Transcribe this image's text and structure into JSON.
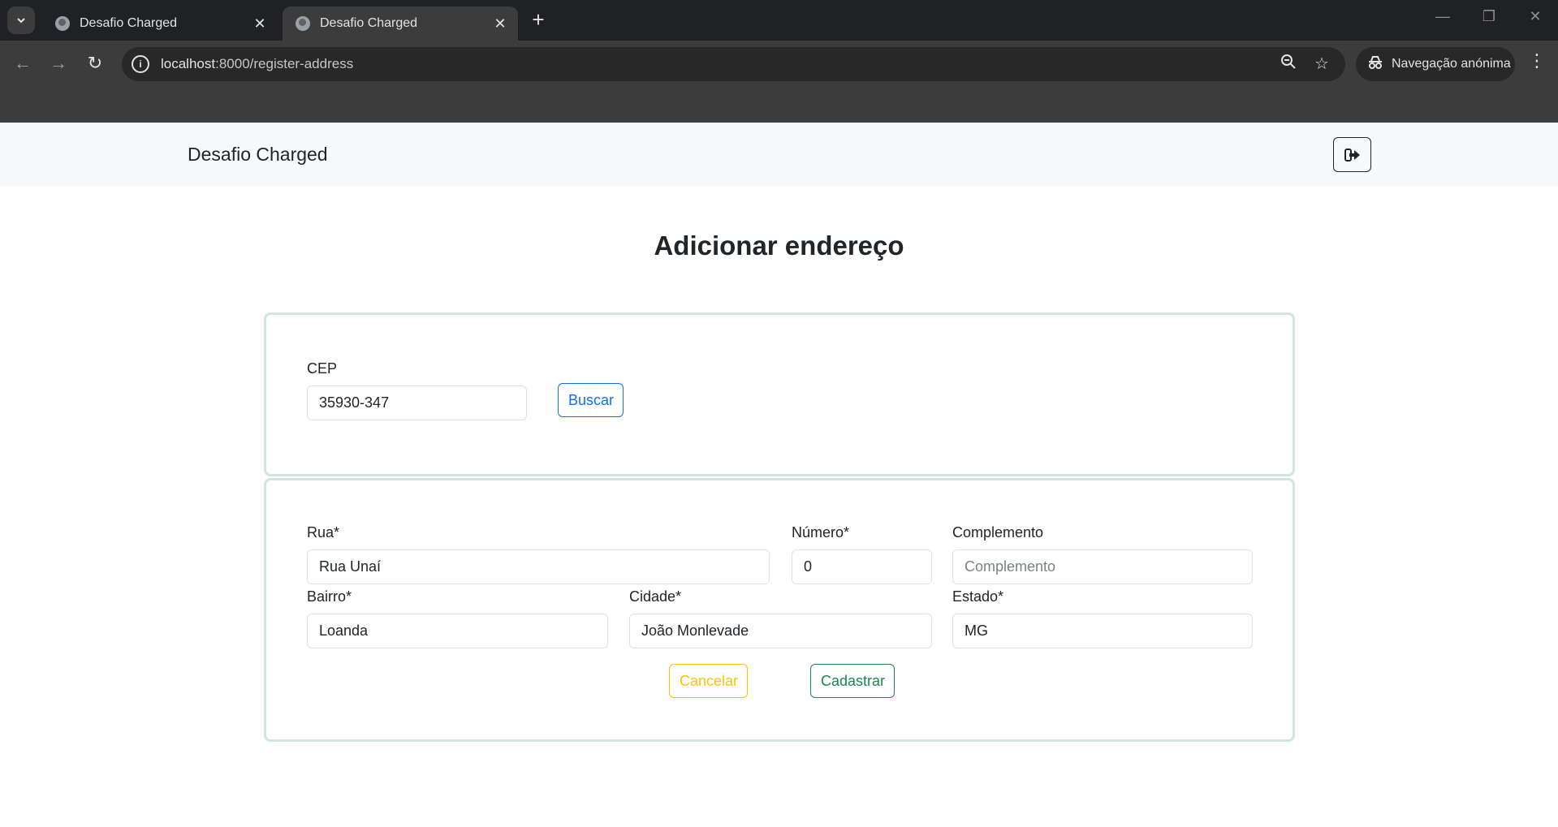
{
  "browser": {
    "tabs": [
      {
        "title": "Desafio Charged"
      },
      {
        "title": "Desafio Charged"
      }
    ],
    "url_host": "localhost",
    "url_path": ":8000/register-address",
    "profile_label": "Navegação anónima"
  },
  "navbar": {
    "brand": "Desafio Charged"
  },
  "page": {
    "title": "Adicionar endereço"
  },
  "cep_form": {
    "label": "CEP",
    "value": "35930-347",
    "search_button": "Buscar"
  },
  "address_form": {
    "rua": {
      "label": "Rua*",
      "value": "Rua Unaí"
    },
    "numero": {
      "label": "Número*",
      "value": "0"
    },
    "complemento": {
      "label": "Complemento",
      "placeholder": "Complemento"
    },
    "bairro": {
      "label": "Bairro*",
      "value": "Loanda"
    },
    "cidade": {
      "label": "Cidade*",
      "value": "João Monlevade"
    },
    "estado": {
      "label": "Estado*",
      "value": "MG"
    },
    "cancel_button": "Cancelar",
    "submit_button": "Cadastrar"
  },
  "colors": {
    "card_border": "#d1e7dd",
    "primary": "#0d6efd",
    "warning": "#ffc107",
    "success": "#198754"
  }
}
